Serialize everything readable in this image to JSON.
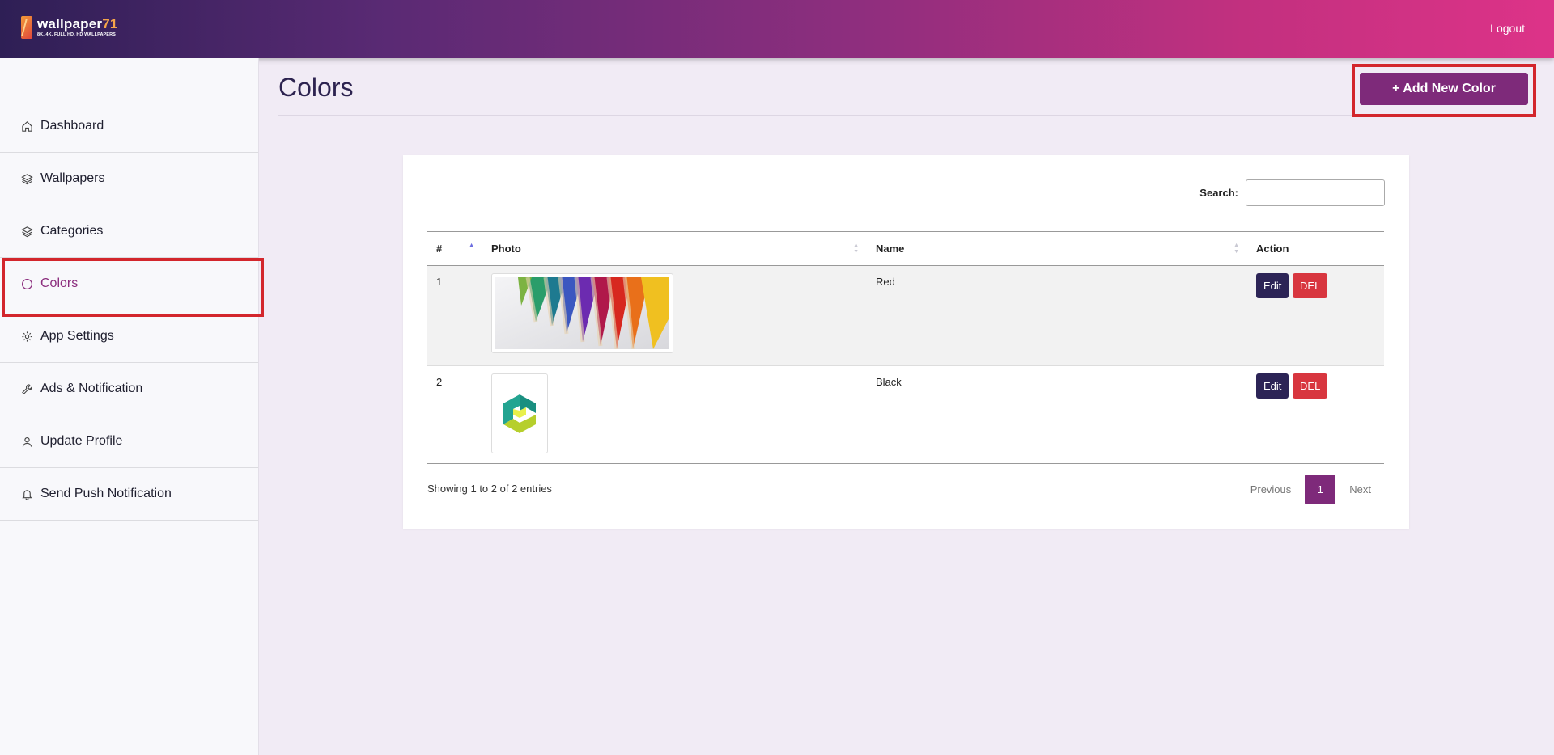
{
  "brand": {
    "name": "wallpaper",
    "name_num": "71",
    "tagline": "8K, 4K, FULL HD, HD WALLPAPERS"
  },
  "header": {
    "logout_label": "Logout"
  },
  "sidebar": {
    "items": [
      {
        "label": "Dashboard",
        "icon": "home-icon"
      },
      {
        "label": "Wallpapers",
        "icon": "layers-icon"
      },
      {
        "label": "Categories",
        "icon": "layers-icon"
      },
      {
        "label": "Colors",
        "icon": "circle-icon",
        "active": true
      },
      {
        "label": "App Settings",
        "icon": "gear-icon"
      },
      {
        "label": "Ads & Notification",
        "icon": "wrench-icon"
      },
      {
        "label": "Update Profile",
        "icon": "user-icon"
      },
      {
        "label": "Send Push Notification",
        "icon": "bell-icon"
      }
    ]
  },
  "page": {
    "title": "Colors",
    "add_button": "+ Add New Color"
  },
  "search": {
    "label": "Search:",
    "value": ""
  },
  "table": {
    "headers": [
      "#",
      "Photo",
      "Name",
      "Action"
    ],
    "rows": [
      {
        "num": "1",
        "photo": "colored-pencils",
        "name": "Red",
        "edit": "Edit",
        "del": "DEL"
      },
      {
        "num": "2",
        "photo": "green-logo",
        "name": "Black",
        "edit": "Edit",
        "del": "DEL"
      }
    ]
  },
  "footer": {
    "info": "Showing 1 to 2 of 2 entries",
    "previous": "Previous",
    "current_page": "1",
    "next": "Next"
  },
  "colors": {
    "accent": "#7e2a7a",
    "edit": "#2c2456",
    "delete": "#d8363f",
    "highlight": "#d3262c"
  }
}
